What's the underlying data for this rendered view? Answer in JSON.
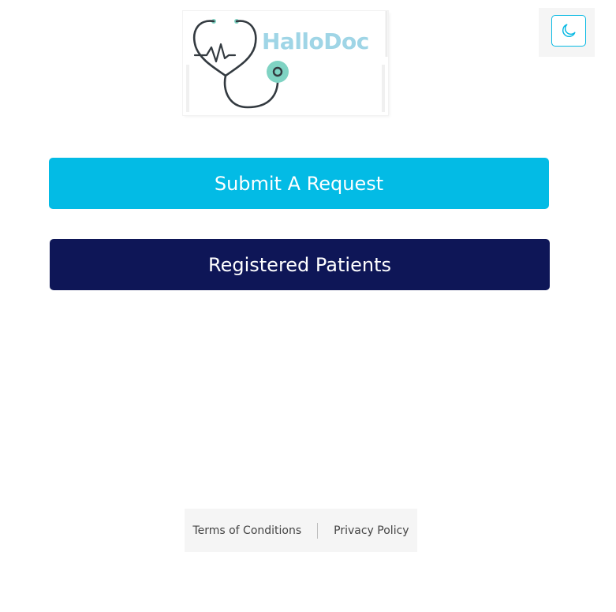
{
  "logo": {
    "brand_text": "HalloDoc",
    "icon": "stethoscope-heartbeat-icon"
  },
  "theme_toggle": {
    "icon": "moon-icon",
    "accent_color": "#08b9e3"
  },
  "actions": {
    "submit_request_label": "Submit A Request",
    "registered_patients_label": "Registered Patients"
  },
  "footer": {
    "terms_label": "Terms of Conditions",
    "privacy_label": "Privacy Policy"
  },
  "colors": {
    "submit_button": "#03bbe5",
    "registered_button": "#0e1657",
    "logo_text": "#9fd5e6",
    "logo_accent": "#7fd3c3"
  }
}
